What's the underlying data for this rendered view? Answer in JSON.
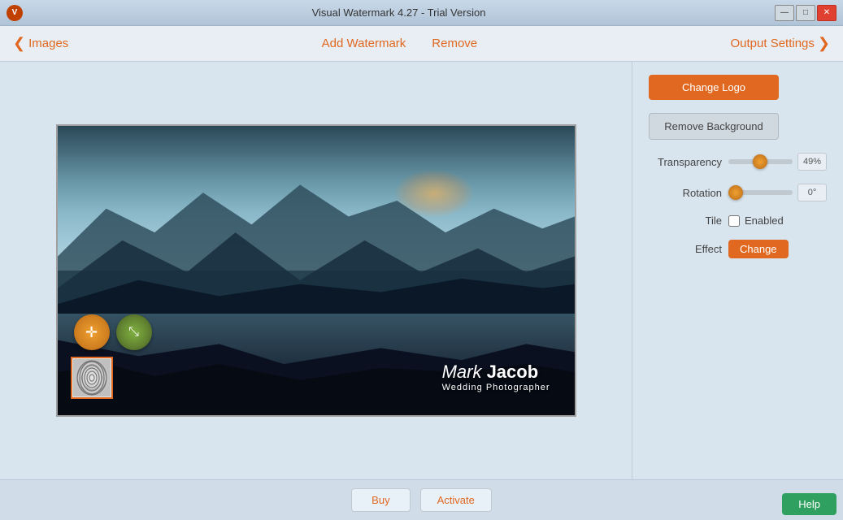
{
  "titleBar": {
    "title": "Visual Watermark 4.27 - Trial Version",
    "minimize_label": "—",
    "maximize_label": "□",
    "close_label": "✕",
    "logo_letter": "V"
  },
  "nav": {
    "back_label": "Images",
    "add_watermark_label": "Add Watermark",
    "remove_label": "Remove",
    "output_settings_label": "Output Settings",
    "back_chevron": "❮",
    "forward_chevron": "❯"
  },
  "controls": {
    "change_logo_label": "Change Logo",
    "remove_background_label": "Remove Background",
    "transparency_label": "Transparency",
    "transparency_value": "49%",
    "transparency_percent": 49,
    "rotation_label": "Rotation",
    "rotation_value": "0°",
    "rotation_percent": 3,
    "tile_label": "Tile",
    "tile_enabled_label": "Enabled",
    "effect_label": "Effect",
    "effect_change_label": "Change"
  },
  "watermark": {
    "name_first": "Mark",
    "name_last": " Jacob",
    "subtitle": "Wedding Photographer"
  },
  "bottomBar": {
    "buy_label": "Buy",
    "activate_label": "Activate",
    "help_label": "Help"
  }
}
